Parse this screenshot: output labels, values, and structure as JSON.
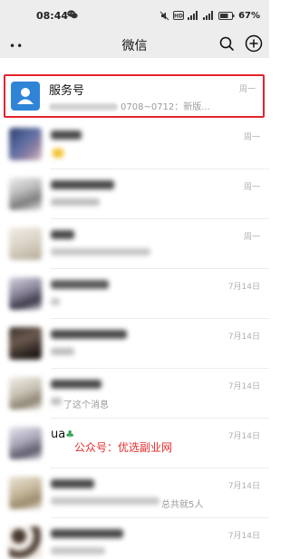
{
  "status_bar": {
    "time": "08:44",
    "battery_percent": "67%",
    "icons": [
      "wechat-icon",
      "mute-icon",
      "hd-icon",
      "signal-icon",
      "signal-icon",
      "battery-icon"
    ]
  },
  "header": {
    "menu_glyph": "••",
    "title": "微信",
    "icons": [
      "search-icon",
      "add-icon"
    ]
  },
  "chats": [
    {
      "name": "服务号",
      "preview_visible": "0708~0712：新版...",
      "time": "周一",
      "highlighted": true
    },
    {
      "name": "",
      "preview": "",
      "time": "周一"
    },
    {
      "name": "",
      "preview": "",
      "time": "周一"
    },
    {
      "name": "",
      "preview": "",
      "time": "周一"
    },
    {
      "name": "",
      "preview": "",
      "time": "7月14日"
    },
    {
      "name": "",
      "preview": "",
      "time": "7月14日"
    },
    {
      "name": "",
      "preview": "了这个消息",
      "time": "7月14日"
    },
    {
      "name": "ua",
      "preview": "",
      "time": "7月14日"
    },
    {
      "name": "",
      "preview": "总共就5人",
      "time": "7月14日"
    },
    {
      "name": "",
      "preview": "",
      "time": "7月14日"
    }
  ],
  "watermark": "公众号：优选副业网",
  "colors": {
    "header_bg": "#ededed",
    "highlight_border": "#e3242b",
    "service_avatar": "#2f84d8",
    "watermark": "#e62d2d"
  }
}
